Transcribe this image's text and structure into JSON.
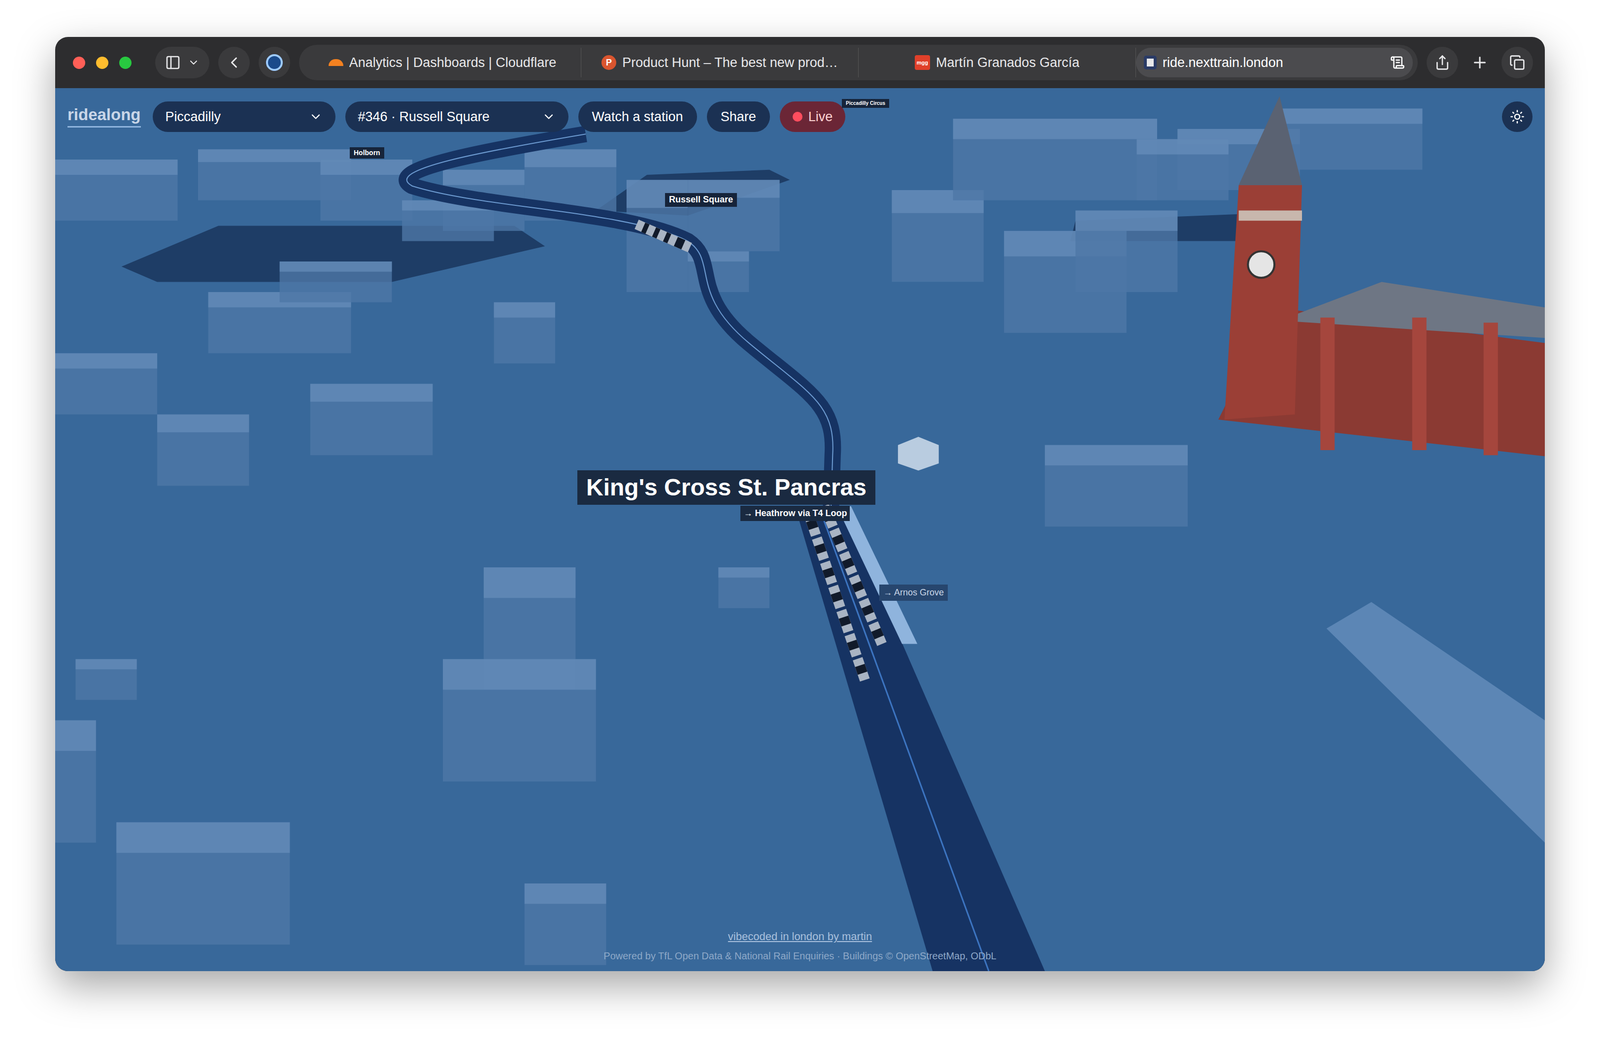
{
  "browser": {
    "tabs": [
      {
        "label": "Analytics | Dashboards | Cloudflare",
        "icon_text": "",
        "selected": false
      },
      {
        "label": "Product Hunt – The best new prod…",
        "icon_text": "P",
        "selected": false
      },
      {
        "label": "Martín Granados García",
        "icon_text": "mgg",
        "selected": false
      },
      {
        "label": "ride.nexttrain.london",
        "icon_text": "",
        "selected": true
      }
    ]
  },
  "app": {
    "logo": "ridealong",
    "line_select": {
      "value": "Piccadilly"
    },
    "train_select": {
      "value": "#346 · Russell Square"
    },
    "buttons": [
      "Watch a station",
      "Share"
    ],
    "live": {
      "label": "Live",
      "on": true
    }
  },
  "map": {
    "station_labels": [
      {
        "label": "Holborn"
      },
      {
        "label": "Russell Square"
      },
      {
        "label": "Piccadilly Circus"
      }
    ],
    "focus_station": {
      "label": "King's Cross St. Pancras",
      "direction": "→ Heathrow via T4 Loop"
    },
    "direction_labels": [
      "→ Arnos Grove"
    ]
  },
  "footer": {
    "credit": "vibecoded in london by martin",
    "attribution": "Powered by TfL Open Data & National Rail Enquiries · Buildings © OpenStreetMap, ODbL"
  }
}
